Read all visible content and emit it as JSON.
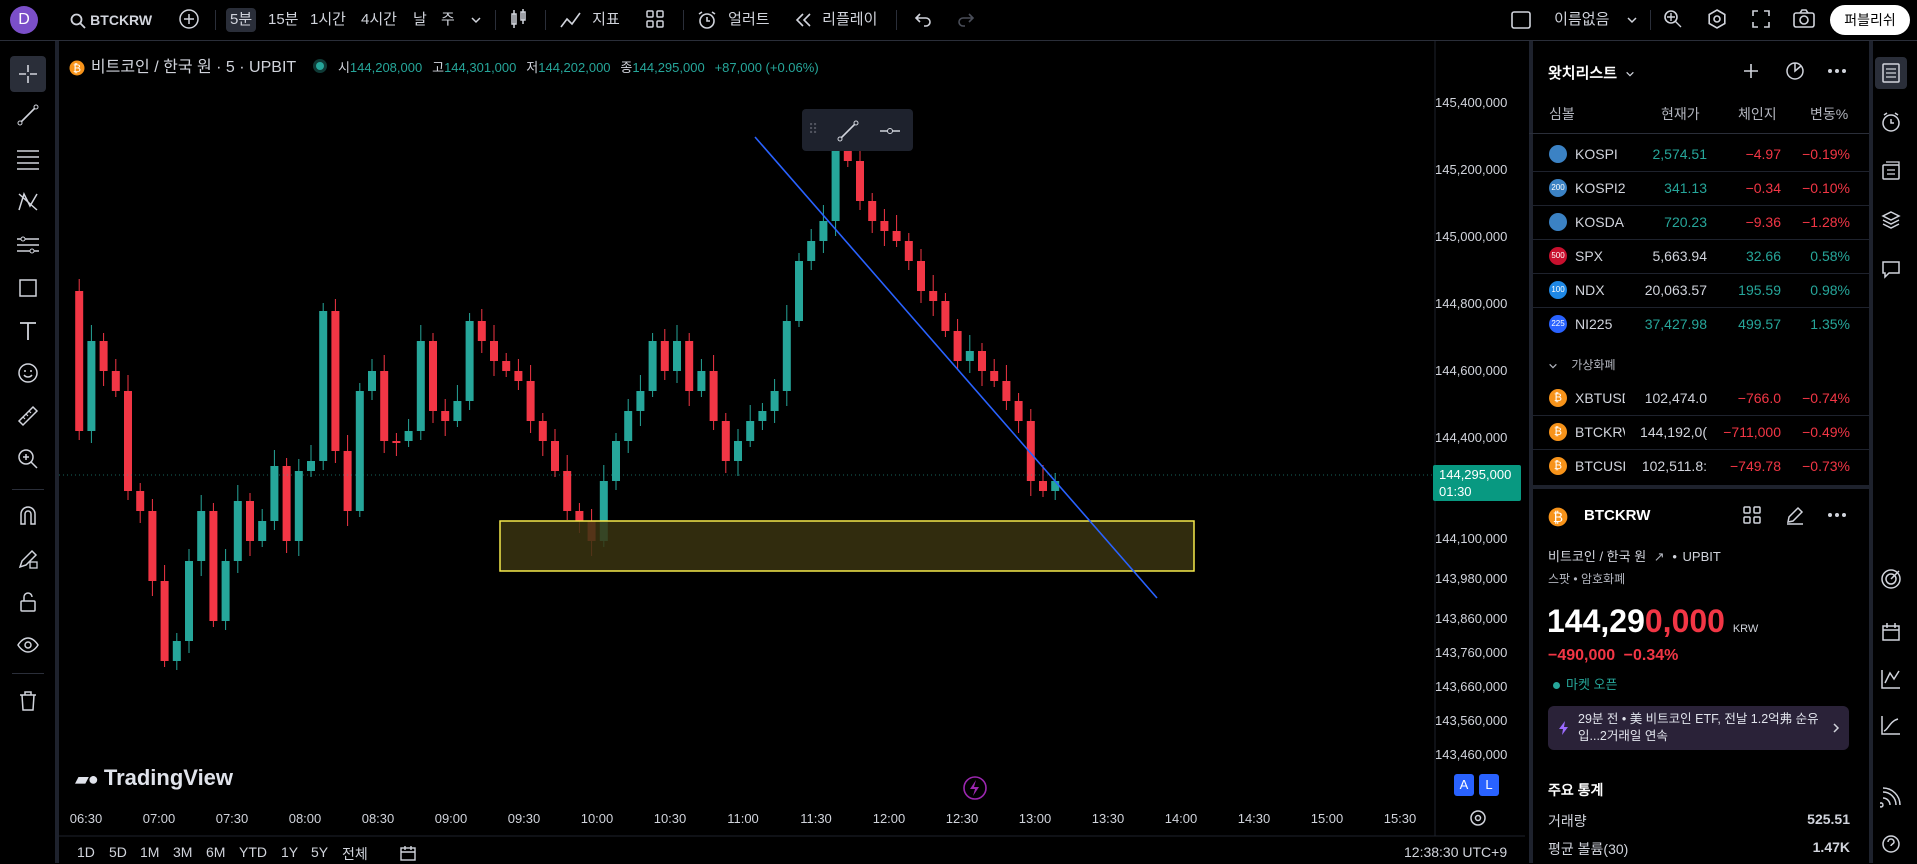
{
  "toolbar": {
    "avatar_letter": "D",
    "symbol": "BTCKRW",
    "intervals": [
      "5분",
      "15분",
      "1시간",
      "4시간",
      "날",
      "주"
    ],
    "indicators_label": "지표",
    "alert_label": "얼러트",
    "replay_label": "리플레이",
    "layout_name": "이름없음",
    "publish_label": "퍼블리쉬"
  },
  "legend": {
    "title": "비트코인 / 한국 원 · 5 · UPBIT",
    "o_label": "시",
    "o_value": "144,208,000",
    "h_label": "고",
    "h_value": "144,301,000",
    "l_label": "저",
    "l_value": "144,202,000",
    "c_label": "종",
    "c_value": "144,295,000",
    "change": "+87,000 (+0.06%)"
  },
  "price_axis": [
    "145,400,000",
    "145,200,000",
    "145,000,000",
    "144,800,000",
    "144,600,000",
    "144,400,000",
    "144,100,000",
    "143,980,000",
    "143,860,000",
    "143,760,000",
    "143,660,000",
    "143,560,000",
    "143,460,000"
  ],
  "current_price": {
    "value": "144,295,000",
    "countdown": "01:30"
  },
  "time_axis": [
    "06:30",
    "07:00",
    "07:30",
    "08:00",
    "08:30",
    "09:00",
    "09:30",
    "10:00",
    "10:30",
    "11:00",
    "11:30",
    "12:00",
    "12:30",
    "13:00",
    "13:30",
    "14:00",
    "14:30",
    "15:00",
    "15:30"
  ],
  "bottom_bar": {
    "ranges": [
      "1D",
      "5D",
      "1M",
      "3M",
      "6M",
      "YTD",
      "1Y",
      "5Y",
      "전체"
    ],
    "clock": "12:38:30 UTC+9"
  },
  "watermark": "TradingView",
  "scale_buttons": [
    "A",
    "L"
  ],
  "watchlist": {
    "title": "왓치리스트",
    "headers": [
      "심볼",
      "현재가",
      "체인지",
      "변동%"
    ],
    "rows": [
      {
        "badge": "",
        "symbol": "KOSPI",
        "price": "2,574.51",
        "change": "−4.97",
        "pct": "−0.19%",
        "badge_color": "#3b82c4"
      },
      {
        "badge": "200",
        "symbol": "KOSPI2(",
        "price": "341.13",
        "change": "−0.34",
        "pct": "−0.10%",
        "badge_color": "#3b82c4"
      },
      {
        "badge": "",
        "symbol": "KOSDA(",
        "price": "720.23",
        "change": "−9.36",
        "pct": "−1.28%",
        "badge_color": "#3b82c4"
      },
      {
        "badge": "500",
        "symbol": "SPX",
        "price": "5,663.94",
        "change": "32.66",
        "pct": "0.58%",
        "badge_color": "#c8102e"
      },
      {
        "badge": "100",
        "symbol": "NDX",
        "price": "20,063.57",
        "change": "195.59",
        "pct": "0.98%",
        "badge_color": "#1e88e5"
      },
      {
        "badge": "225",
        "symbol": "NI225",
        "price": "37,427.98",
        "change": "499.57",
        "pct": "1.35%",
        "badge_color": "#2962ff"
      }
    ],
    "section": "가상화폐",
    "crypto_rows": [
      {
        "symbol": "XBTUSD",
        "price": "102,474.0",
        "change": "−766.0",
        "pct": "−0.74%"
      },
      {
        "symbol": "BTCKRW",
        "price": "144,192,0(",
        "change": "−711,000",
        "pct": "−0.49%"
      },
      {
        "symbol": "BTCUSD",
        "price": "102,511.8:",
        "change": "−749.78",
        "pct": "−0.73%"
      }
    ]
  },
  "details": {
    "symbol": "BTCKRW",
    "name": "비트코인 / 한국 원",
    "exchange": "UPBIT",
    "type": "스팟 • 암호화폐",
    "price_main": "144,29",
    "price_tail": "0,000",
    "currency": "KRW",
    "change": "−490,000",
    "change_pct": "−0.34%",
    "market_status": "마켓 오픈",
    "news": "29분 전 • 美 비트코인 ETF, 전날 1.2억弗 순유입...2거래일 연속",
    "stats_title": "주요 통계",
    "volume_label": "거래량",
    "volume_value": "525.51",
    "avg_label": "평균 볼륨(30)",
    "avg_value": "1.47K"
  },
  "colors": {
    "up": "#26a69a",
    "down": "#f23645",
    "trendline": "#2962ff",
    "zone_border": "#f5e94b",
    "zone_fill": "#3a3410",
    "accent": "#2962ff"
  }
}
